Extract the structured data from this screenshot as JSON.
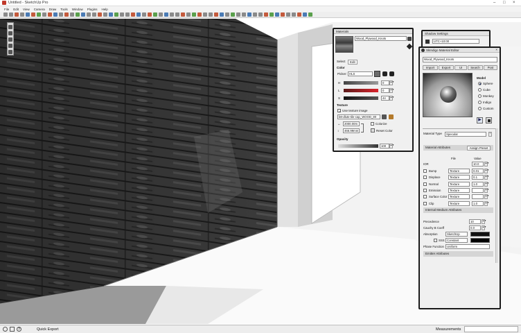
{
  "app": {
    "title": "Untitled - SketchUp Pro",
    "menus": [
      "File",
      "Edit",
      "View",
      "Camera",
      "Draw",
      "Tools",
      "Window",
      "Plugins",
      "Help"
    ]
  },
  "status": {
    "hint": "Quick Export",
    "measurements_label": "Measurements"
  },
  "materials": {
    "title": "Materials",
    "material_name": "Wood_Plywood_Knots",
    "tabs": [
      "Select",
      "Edit"
    ],
    "active_tab": "Edit",
    "color_heading": "Color",
    "picker_label": "Picker:",
    "picker_value": "HLS",
    "h_label": "H",
    "h_value": "0",
    "l_label": "L",
    "l_value": "0",
    "s_label": "S",
    "s_value": "44",
    "texture_heading": "Texture",
    "use_texture_label": "Use texture image",
    "texture_file": "b8-dlute-tile-cap_WOOD_80",
    "width_value": "2000.00m",
    "height_value": "466.99mm",
    "colorize_label": "Colorize",
    "reset_color_label": "Reset Color",
    "opacity_heading": "Opacity",
    "opacity_value": "100"
  },
  "shadow": {
    "title": "Shadow Settings",
    "utc_value": "UTC+10:00"
  },
  "indigo": {
    "title": "SkIndigo Material Editor",
    "material_select": "Wood_Plywood_Knots",
    "buttons": [
      "Import",
      "Export",
      "UI",
      "Search",
      "Post"
    ],
    "model_heading": "Model",
    "model_options": [
      "Sphere",
      "Cube",
      "Monkey",
      "Indigo",
      "Custom"
    ],
    "model_selected": "Sphere",
    "material_type_label": "Material Type",
    "material_type_value": "Specular",
    "material_attributes": "Material Attributes",
    "assign_preset": "Assign Preset",
    "col_file": "File",
    "col_value": "Value",
    "ior_label": "IOR",
    "ior_value": "10.0",
    "rows": [
      {
        "label": "Bump",
        "type": "Texture",
        "value": "0.01"
      },
      {
        "label": "Displace",
        "type": "Texture",
        "value": "0.1"
      },
      {
        "label": "Normal",
        "type": "Texture",
        "value": "1.0"
      },
      {
        "label": "Emission",
        "type": "Texture",
        "value": ""
      },
      {
        "label": "Surface Color",
        "type": "Texture",
        "value": ""
      },
      {
        "label": "Clip",
        "type": "Texture",
        "value": "1.0"
      }
    ],
    "internal_medium": "Internal Medium Attributes",
    "precedence_label": "Precedence",
    "precedence_value": "10",
    "cauchy_label": "Cauchy B Coeff",
    "cauchy_value": "0.0",
    "absorption_label": "Absorption",
    "absorption_value": "SketchUp",
    "sss_label": "SSS",
    "sss_value": "Constant",
    "phase_label": "Phase Function",
    "phase_value": "Uniform",
    "emitter_attributes": "Emitter Attributes"
  }
}
